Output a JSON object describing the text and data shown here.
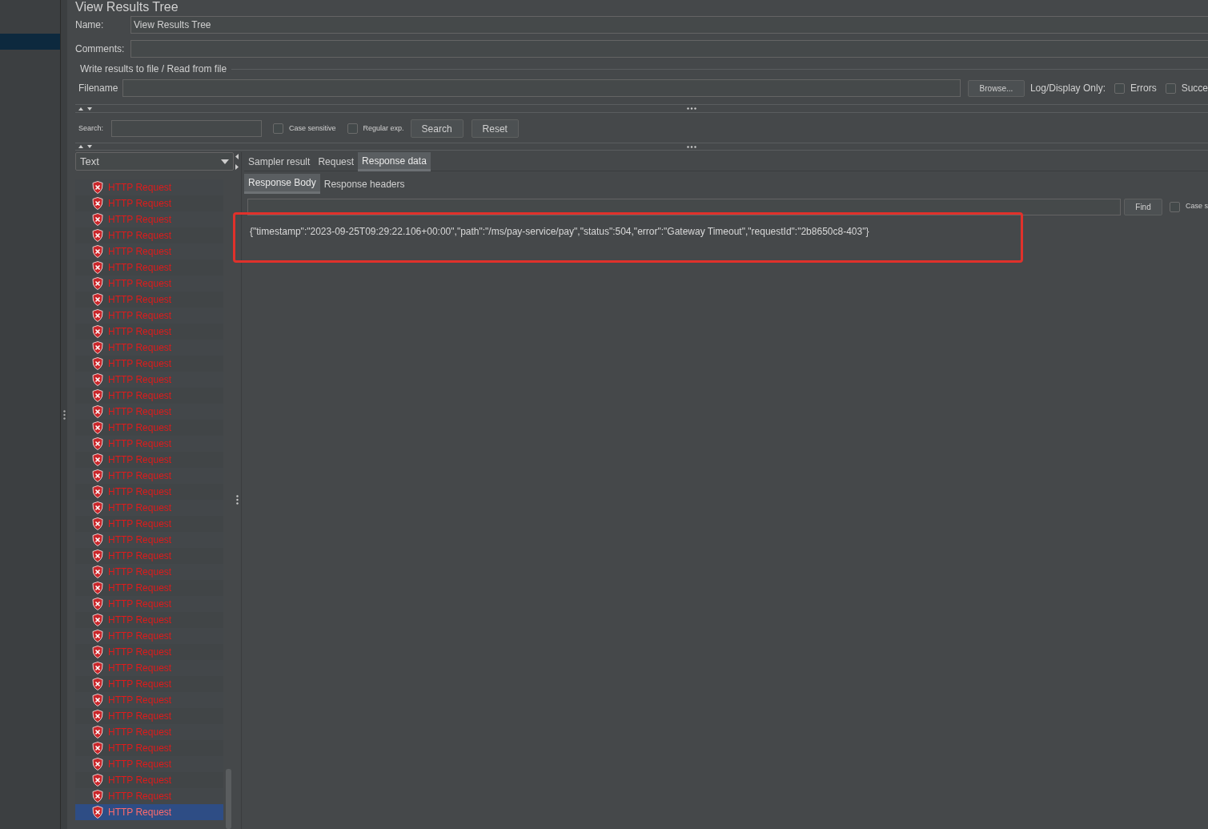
{
  "window": {
    "title": "View Results Tree"
  },
  "name_field": {
    "label": "Name:",
    "value": "View Results Tree"
  },
  "comments_field": {
    "label": "Comments:"
  },
  "file_section": {
    "legend": "Write results to file / Read from file",
    "filename_label": "Filename",
    "browse_button": "Browse...",
    "log_display_label": "Log/Display Only:",
    "checkboxes": [
      {
        "label": "Errors",
        "checked": false
      },
      {
        "label": "Succe",
        "checked": false
      }
    ]
  },
  "search": {
    "label": "Search:",
    "options": [
      {
        "label": "Case sensitive",
        "checked": false
      },
      {
        "label": "Regular exp.",
        "checked": false
      }
    ],
    "buttons": [
      "Search",
      "Reset"
    ]
  },
  "renderer": {
    "value": "Text"
  },
  "samples": [
    {
      "label": "HTTP Request",
      "selected": false
    },
    {
      "label": "HTTP Request",
      "selected": false
    },
    {
      "label": "HTTP Request",
      "selected": false
    },
    {
      "label": "HTTP Request",
      "selected": false
    },
    {
      "label": "HTTP Request",
      "selected": false
    },
    {
      "label": "HTTP Request",
      "selected": false
    },
    {
      "label": "HTTP Request",
      "selected": false
    },
    {
      "label": "HTTP Request",
      "selected": false
    },
    {
      "label": "HTTP Request",
      "selected": false
    },
    {
      "label": "HTTP Request",
      "selected": false
    },
    {
      "label": "HTTP Request",
      "selected": false
    },
    {
      "label": "HTTP Request",
      "selected": false
    },
    {
      "label": "HTTP Request",
      "selected": false
    },
    {
      "label": "HTTP Request",
      "selected": false
    },
    {
      "label": "HTTP Request",
      "selected": false
    },
    {
      "label": "HTTP Request",
      "selected": false
    },
    {
      "label": "HTTP Request",
      "selected": false
    },
    {
      "label": "HTTP Request",
      "selected": false
    },
    {
      "label": "HTTP Request",
      "selected": false
    },
    {
      "label": "HTTP Request",
      "selected": false
    },
    {
      "label": "HTTP Request",
      "selected": false
    },
    {
      "label": "HTTP Request",
      "selected": false
    },
    {
      "label": "HTTP Request",
      "selected": false
    },
    {
      "label": "HTTP Request",
      "selected": false
    },
    {
      "label": "HTTP Request",
      "selected": false
    },
    {
      "label": "HTTP Request",
      "selected": false
    },
    {
      "label": "HTTP Request",
      "selected": false
    },
    {
      "label": "HTTP Request",
      "selected": false
    },
    {
      "label": "HTTP Request",
      "selected": false
    },
    {
      "label": "HTTP Request",
      "selected": false
    },
    {
      "label": "HTTP Request",
      "selected": false
    },
    {
      "label": "HTTP Request",
      "selected": false
    },
    {
      "label": "HTTP Request",
      "selected": false
    },
    {
      "label": "HTTP Request",
      "selected": false
    },
    {
      "label": "HTTP Request",
      "selected": false
    },
    {
      "label": "HTTP Request",
      "selected": false
    },
    {
      "label": "HTTP Request",
      "selected": false
    },
    {
      "label": "HTTP Request",
      "selected": false
    },
    {
      "label": "HTTP Request",
      "selected": false
    },
    {
      "label": "HTTP Request",
      "selected": true
    }
  ],
  "tabs": [
    {
      "label": "Sampler result",
      "selected": false
    },
    {
      "label": "Request",
      "selected": false
    },
    {
      "label": "Response data",
      "selected": true
    }
  ],
  "subtabs": [
    {
      "label": "Response Body",
      "selected": true
    },
    {
      "label": "Response headers",
      "selected": false
    }
  ],
  "find": {
    "button": "Find",
    "options": [
      {
        "label": "Case s",
        "checked": false
      }
    ]
  },
  "response_body": "{\"timestamp\":\"2023-09-25T09:29:22.106+00:00\",\"path\":\"/ms/pay-service/pay\",\"status\":504,\"error\":\"Gateway Timeout\",\"requestId\":\"2b8650c8-403\"}"
}
